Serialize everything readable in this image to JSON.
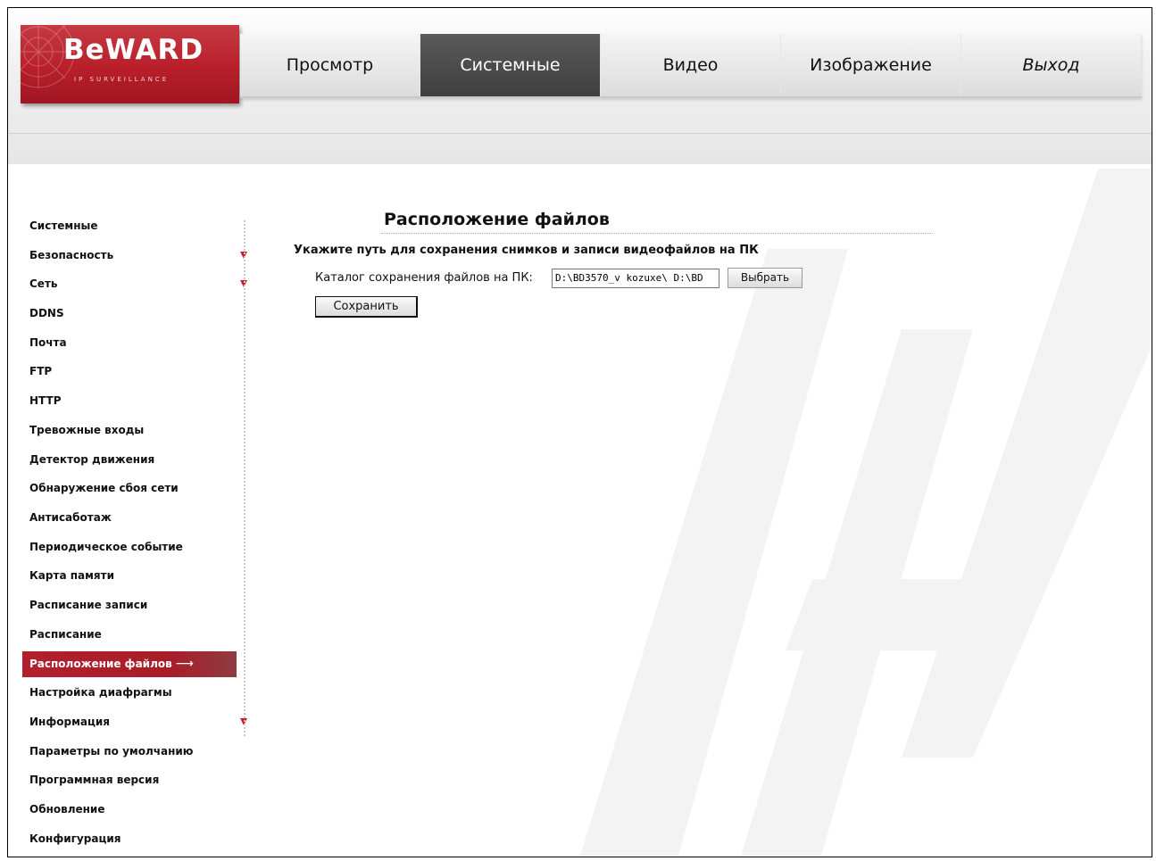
{
  "brand": {
    "logo_text": "BeWARD",
    "logo_sub": "IP SURVEILLANCE"
  },
  "nav": {
    "tabs": [
      {
        "label": "Просмотр",
        "active": false
      },
      {
        "label": "Системные",
        "active": true
      },
      {
        "label": "Видео",
        "active": false
      },
      {
        "label": "Изображение",
        "active": false
      },
      {
        "label": "Выход",
        "active": false
      }
    ]
  },
  "sidebar": {
    "items": [
      {
        "label": "Системные"
      },
      {
        "label": "Безопасность",
        "expandable": true
      },
      {
        "label": "Сеть",
        "expandable": true
      },
      {
        "label": "DDNS"
      },
      {
        "label": "Почта"
      },
      {
        "label": "FTP"
      },
      {
        "label": "HTTP"
      },
      {
        "label": "Тревожные входы"
      },
      {
        "label": "Детектор движения"
      },
      {
        "label": "Обнаружение сбоя сети"
      },
      {
        "label": "Антисаботаж"
      },
      {
        "label": "Периодическое событие"
      },
      {
        "label": "Карта памяти"
      },
      {
        "label": "Расписание записи"
      },
      {
        "label": "Расписание"
      },
      {
        "label": "Расположение файлов",
        "active": true
      },
      {
        "label": "Настройка диафрагмы"
      },
      {
        "label": "Информация",
        "expandable": true
      },
      {
        "label": "Параметры по умолчанию"
      },
      {
        "label": "Программная версия"
      },
      {
        "label": "Обновление"
      },
      {
        "label": "Конфигурация"
      }
    ]
  },
  "main": {
    "title": "Расположение файлов",
    "subtitle": "Укажите путь для сохранения снимков и записи видеофайлов на ПК",
    "field_label": "Каталог сохранения файлов на ПК:",
    "path_value": "D:\\BD3570_v kozuxe\\ D:\\BD",
    "choose_button": "Выбрать",
    "save_button": "Сохранить"
  },
  "colors": {
    "accent": "#b81f2b",
    "active_tab": "#4a4a4a",
    "arrow": "#c81e2a"
  },
  "icons": {
    "expand": "triangle-down-icon",
    "active_marker": "arrow-right-icon"
  }
}
